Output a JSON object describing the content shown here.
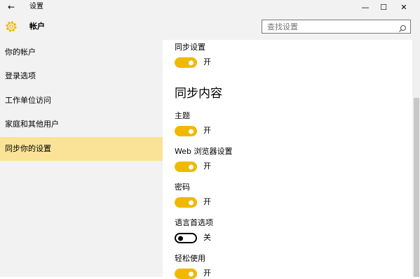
{
  "window": {
    "back_icon": "back-arrow-icon",
    "title": "设置",
    "minimize_glyph": "—",
    "maximize_glyph": "☐",
    "close_glyph": "✕"
  },
  "header": {
    "icon": "gear-icon",
    "title": "帐户",
    "search_placeholder": "查找设置",
    "search_icon": "search-icon"
  },
  "sidebar": {
    "items": [
      {
        "label": "你的帐户",
        "active": false
      },
      {
        "label": "登录选项",
        "active": false
      },
      {
        "label": "工作单位访问",
        "active": false
      },
      {
        "label": "家庭和其他用户",
        "active": false
      },
      {
        "label": "同步你的设置",
        "active": true
      }
    ]
  },
  "content": {
    "sync_settings": {
      "label": "同步设置",
      "on": true,
      "state": "开"
    },
    "section_title": "同步内容",
    "items": [
      {
        "label": "主题",
        "on": true,
        "state": "开"
      },
      {
        "label": "Web 浏览器设置",
        "on": true,
        "state": "开"
      },
      {
        "label": "密码",
        "on": true,
        "state": "开"
      },
      {
        "label": "语言首选项",
        "on": false,
        "state": "关"
      },
      {
        "label": "轻松使用",
        "on": true,
        "state": "开"
      }
    ]
  },
  "colors": {
    "accent": "#f0b900",
    "selected_nav": "#fae396",
    "chrome_bg": "#f2f2f2"
  }
}
